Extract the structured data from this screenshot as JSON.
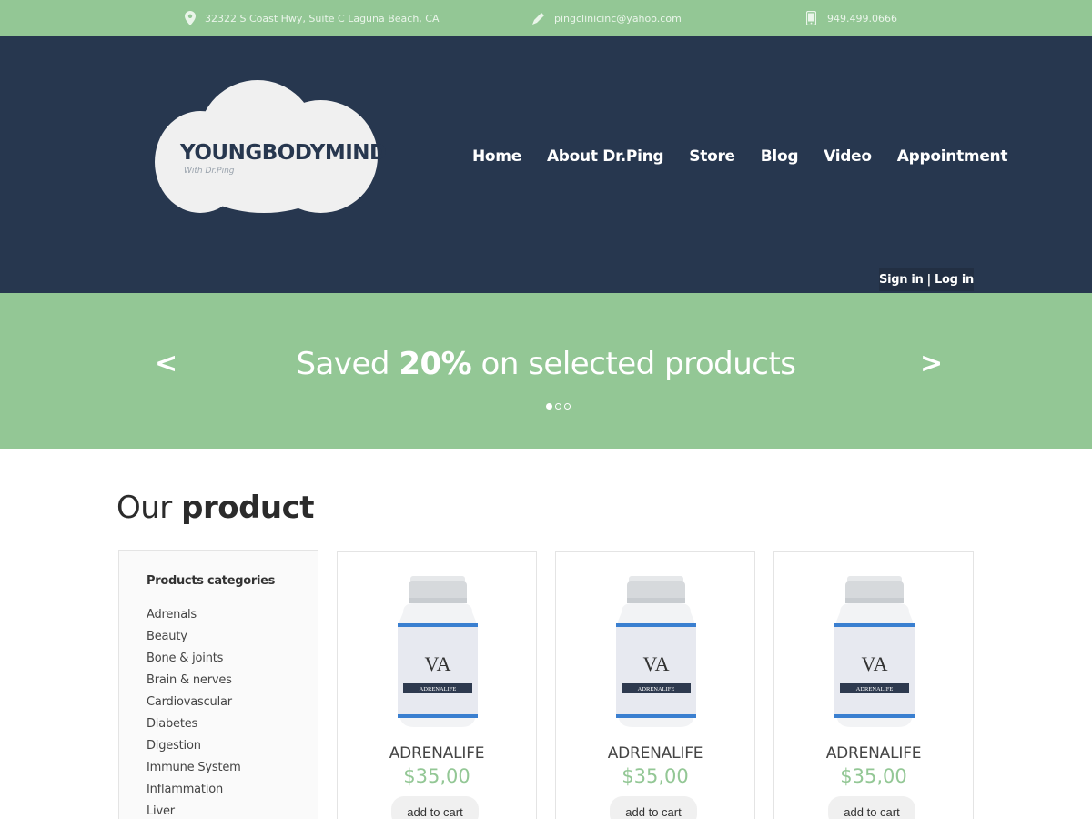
{
  "topbar": {
    "address": "32322 S Coast Hwy, Suite C Laguna Beach, CA",
    "email": "pingclinicinc@yahoo.com",
    "phone": "949.499.0666",
    "icons": [
      "location-pin-icon",
      "pencil-icon",
      "phone-icon"
    ]
  },
  "logo": {
    "title": "YOUNGBODYMIND",
    "subtitle": "With Dr.Ping"
  },
  "nav": [
    "Home",
    "About Dr.Ping",
    "Store",
    "Blog",
    "Video",
    "Appointment"
  ],
  "auth": {
    "signin": "Sign in",
    "separator": "|",
    "login": "Log in"
  },
  "banner": {
    "prev": "<",
    "next": ">",
    "headline_pre": "Saved",
    "headline_bold": "20%",
    "headline_post": "on selected products",
    "active_slide": 1,
    "slide_count": 3
  },
  "section": {
    "title_light": "Our",
    "title_bold": "product"
  },
  "sidebar": {
    "title": "Products categories",
    "categories": [
      "Adrenals",
      "Beauty",
      "Bone & joints",
      "Brain & nerves",
      "Cardiovascular",
      "Diabetes",
      "Digestion",
      "Immune System",
      "Inflammation",
      "Liver"
    ]
  },
  "products": [
    {
      "name": "ADRENALIFE",
      "price": "$35,00",
      "button": "add to cart",
      "label": "ADRENALIFE"
    },
    {
      "name": "ADRENALIFE",
      "price": "$35,00",
      "button": "add to cart",
      "label": "ADRENALIFE"
    },
    {
      "name": "ADRENALIFE",
      "price": "$35,00",
      "button": "add to cart",
      "label": "ADRENALIFE"
    }
  ],
  "colors": {
    "green": "#93c795",
    "navy": "#27374f",
    "white": "#ffffff"
  }
}
